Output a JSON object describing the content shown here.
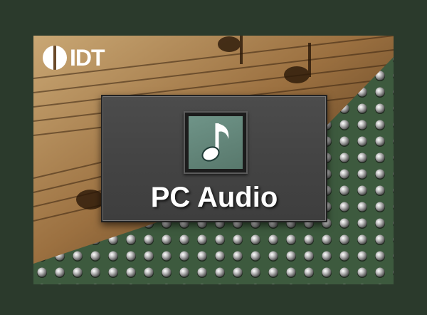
{
  "logo": {
    "text": "IDT"
  },
  "panel": {
    "title": "PC Audio",
    "icon": "music-note-icon"
  },
  "colors": {
    "frame": "#2b3a2c",
    "panel": "#474747",
    "icon_background": "#6a8d80",
    "board": "#3f5b40",
    "paper": "#b38a55"
  }
}
